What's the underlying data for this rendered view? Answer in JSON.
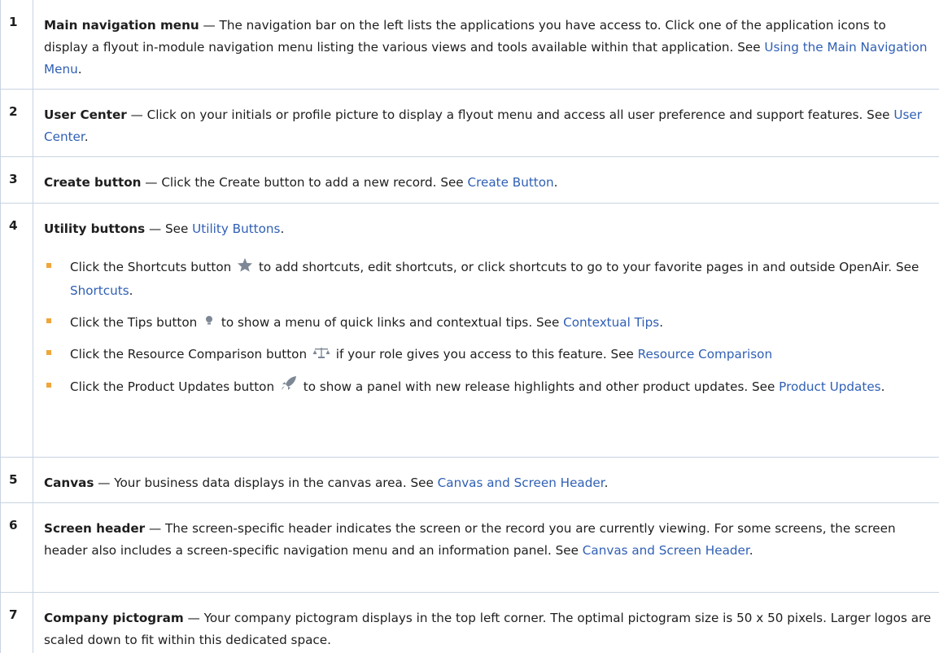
{
  "rows": [
    {
      "num": "1",
      "term": "Main navigation menu",
      "text": " — The navigation bar on the left lists the applications you have access to. Click one of the application icons to display a flyout in-module navigation menu listing the various views and tools available within that application. See ",
      "link": "Using the Main Navigation Menu",
      "end": "."
    },
    {
      "num": "2",
      "term": "User Center",
      "text": " — Click on your initials or profile picture to display a flyout menu and access all user preference and support features. See ",
      "link": "User Center",
      "end": "."
    },
    {
      "num": "3",
      "term": "Create button",
      "text": " — Click the Create button to add a new record. See ",
      "link": "Create Button",
      "end": "."
    },
    {
      "num": "4",
      "term": "Utility buttons",
      "text": " — See ",
      "link": "Utility Buttons",
      "end": "."
    },
    {
      "num": "5",
      "term": "Canvas",
      "text": " — Your business data displays in the canvas area. See ",
      "link": "Canvas and Screen Header",
      "end": "."
    },
    {
      "num": "6",
      "term": "Screen header",
      "text": " — The screen-specific header indicates the screen or the record you are currently viewing. For some screens, the screen header also includes a screen-specific navigation menu and an information panel. See ",
      "link": "Canvas and Screen Header",
      "end": "."
    },
    {
      "num": "7",
      "term": "Company pictogram",
      "text": " — Your company pictogram displays in the top left corner. The optimal pictogram size is 50 x 50 pixels. Larger logos are scaled down to fit within this dedicated space.",
      "link": "",
      "end": ""
    }
  ],
  "utility_bullets": [
    {
      "pre": "Click the Shortcuts button ",
      "icon": "star-icon",
      "post": " to add shortcuts, edit shortcuts, or click shortcuts to go to your favorite pages in and outside OpenAir. See ",
      "link": "Shortcuts",
      "end": "."
    },
    {
      "pre": "Click the Tips button ",
      "icon": "lightbulb-icon",
      "post": " to show a menu of quick links and contextual tips. See ",
      "link": "Contextual Tips",
      "end": "."
    },
    {
      "pre": "Click the Resource Comparison button ",
      "icon": "scale-icon",
      "post": " if your role gives you access to this feature. See ",
      "link": "Resource Comparison",
      "end": ""
    },
    {
      "pre": "Click the Product Updates button ",
      "icon": "rocket-icon",
      "post": " to show a panel with new release highlights and other product updates. See ",
      "link": "Product Updates",
      "end": "."
    }
  ],
  "colors": {
    "link": "#2f5fb4",
    "bullet": "#f0a63b",
    "border": "#c8d4e2",
    "icon": "#7d8795"
  }
}
